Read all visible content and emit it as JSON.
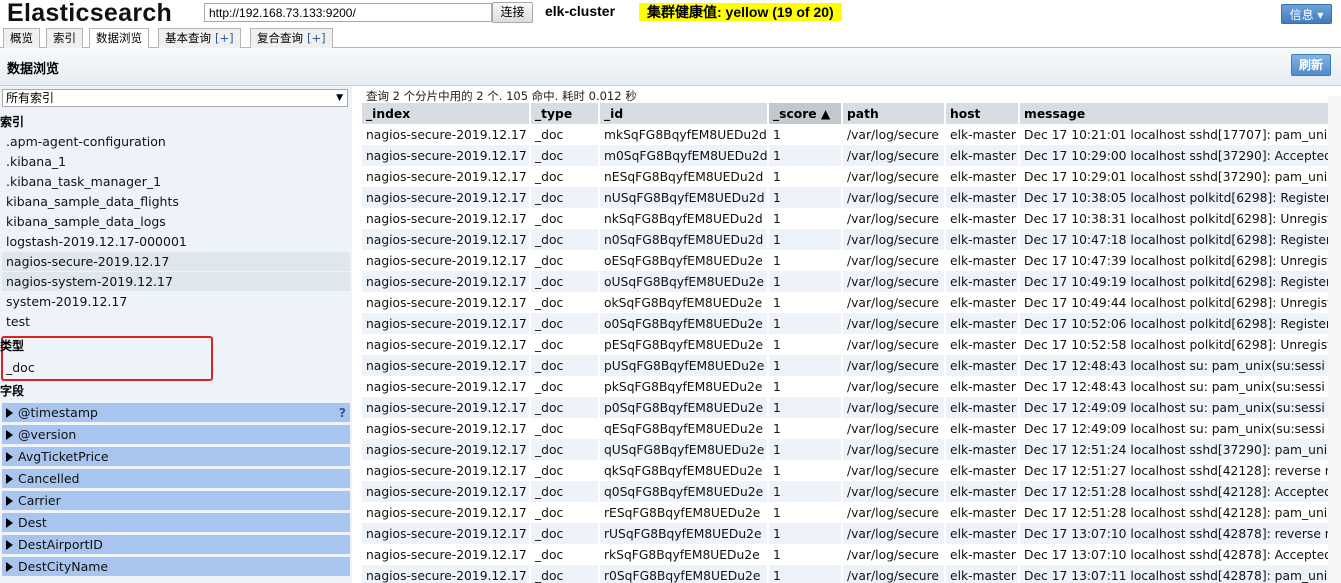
{
  "header": {
    "app_title": "Elasticsearch",
    "url_value": "http://192.168.73.133:9200/",
    "connect_label": "连接",
    "cluster_name": "elk-cluster",
    "health_text": "集群健康值: yellow (19 of 20)",
    "info_label": "信息 ▾",
    "health_color": "#ffff00"
  },
  "tabs": [
    {
      "label": "概览",
      "plus": ""
    },
    {
      "label": "索引",
      "plus": ""
    },
    {
      "label": "数据浏览",
      "plus": ""
    },
    {
      "label": "基本查询",
      "plus": "[+]"
    },
    {
      "label": "复合查询",
      "plus": "[+]"
    }
  ],
  "panel": {
    "title": "数据浏览",
    "refresh_label": "刷新"
  },
  "sidebar": {
    "index_select": "所有索引",
    "indices_header": "索引",
    "indices": [
      ".apm-agent-configuration",
      ".kibana_1",
      ".kibana_task_manager_1",
      "kibana_sample_data_flights",
      "kibana_sample_data_logs",
      "logstash-2019.12.17-000001",
      "nagios-secure-2019.12.17",
      "nagios-system-2019.12.17",
      "system-2019.12.17",
      "test"
    ],
    "types_header": "类型",
    "types": [
      "_doc"
    ],
    "fields_header": "字段",
    "fields": [
      "@timestamp",
      "@version",
      "AvgTicketPrice",
      "Cancelled",
      "Carrier",
      "Dest",
      "DestAirportID",
      "DestCityName"
    ],
    "help_icon": "?"
  },
  "results": {
    "summary": "查询 2 个分片中用的 2 个. 105 命中. 耗时 0.012 秒",
    "columns": [
      "_index",
      "_type",
      "_id",
      "_score ▲",
      "path",
      "host",
      "message"
    ],
    "rows": [
      [
        "nagios-secure-2019.12.17",
        "_doc",
        "mkSqFG8BqyfEM8UEDu2d",
        "1",
        "/var/log/secure",
        "elk-master",
        "Dec 17 10:21:01 localhost sshd[17707]: pam_uni"
      ],
      [
        "nagios-secure-2019.12.17",
        "_doc",
        "m0SqFG8BqyfEM8UEDu2d",
        "1",
        "/var/log/secure",
        "elk-master",
        "Dec 17 10:29:00 localhost sshd[37290]: Accepted"
      ],
      [
        "nagios-secure-2019.12.17",
        "_doc",
        "nESqFG8BqyfEM8UEDu2d",
        "1",
        "/var/log/secure",
        "elk-master",
        "Dec 17 10:29:01 localhost sshd[37290]: pam_uni"
      ],
      [
        "nagios-secure-2019.12.17",
        "_doc",
        "nUSqFG8BqyfEM8UEDu2d",
        "1",
        "/var/log/secure",
        "elk-master",
        "Dec 17 10:38:05 localhost polkitd[6298]: Register"
      ],
      [
        "nagios-secure-2019.12.17",
        "_doc",
        "nkSqFG8BqyfEM8UEDu2d",
        "1",
        "/var/log/secure",
        "elk-master",
        "Dec 17 10:38:31 localhost polkitd[6298]: Unregist"
      ],
      [
        "nagios-secure-2019.12.17",
        "_doc",
        "n0SqFG8BqyfEM8UEDu2d",
        "1",
        "/var/log/secure",
        "elk-master",
        "Dec 17 10:47:18 localhost polkitd[6298]: Register"
      ],
      [
        "nagios-secure-2019.12.17",
        "_doc",
        "oESqFG8BqyfEM8UEDu2e",
        "1",
        "/var/log/secure",
        "elk-master",
        "Dec 17 10:47:39 localhost polkitd[6298]: Unregist"
      ],
      [
        "nagios-secure-2019.12.17",
        "_doc",
        "oUSqFG8BqyfEM8UEDu2e",
        "1",
        "/var/log/secure",
        "elk-master",
        "Dec 17 10:49:19 localhost polkitd[6298]: Register"
      ],
      [
        "nagios-secure-2019.12.17",
        "_doc",
        "okSqFG8BqyfEM8UEDu2e",
        "1",
        "/var/log/secure",
        "elk-master",
        "Dec 17 10:49:44 localhost polkitd[6298]: Unregist"
      ],
      [
        "nagios-secure-2019.12.17",
        "_doc",
        "o0SqFG8BqyfEM8UEDu2e",
        "1",
        "/var/log/secure",
        "elk-master",
        "Dec 17 10:52:06 localhost polkitd[6298]: Register"
      ],
      [
        "nagios-secure-2019.12.17",
        "_doc",
        "pESqFG8BqyfEM8UEDu2e",
        "1",
        "/var/log/secure",
        "elk-master",
        "Dec 17 10:52:58 localhost polkitd[6298]: Unregist"
      ],
      [
        "nagios-secure-2019.12.17",
        "_doc",
        "pUSqFG8BqyfEM8UEDu2e",
        "1",
        "/var/log/secure",
        "elk-master",
        "Dec 17 12:48:43 localhost su: pam_unix(su:sessi"
      ],
      [
        "nagios-secure-2019.12.17",
        "_doc",
        "pkSqFG8BqyfEM8UEDu2e",
        "1",
        "/var/log/secure",
        "elk-master",
        "Dec 17 12:48:43 localhost su: pam_unix(su:sessi"
      ],
      [
        "nagios-secure-2019.12.17",
        "_doc",
        "p0SqFG8BqyfEM8UEDu2e",
        "1",
        "/var/log/secure",
        "elk-master",
        "Dec 17 12:49:09 localhost su: pam_unix(su:sessi"
      ],
      [
        "nagios-secure-2019.12.17",
        "_doc",
        "qESqFG8BqyfEM8UEDu2e",
        "1",
        "/var/log/secure",
        "elk-master",
        "Dec 17 12:49:09 localhost su: pam_unix(su:sessi"
      ],
      [
        "nagios-secure-2019.12.17",
        "_doc",
        "qUSqFG8BqyfEM8UEDu2e",
        "1",
        "/var/log/secure",
        "elk-master",
        "Dec 17 12:51:24 localhost sshd[37290]: pam_uni"
      ],
      [
        "nagios-secure-2019.12.17",
        "_doc",
        "qkSqFG8BqyfEM8UEDu2e",
        "1",
        "/var/log/secure",
        "elk-master",
        "Dec 17 12:51:27 localhost sshd[42128]: reverse n"
      ],
      [
        "nagios-secure-2019.12.17",
        "_doc",
        "q0SqFG8BqyfEM8UEDu2e",
        "1",
        "/var/log/secure",
        "elk-master",
        "Dec 17 12:51:28 localhost sshd[42128]: Accepted"
      ],
      [
        "nagios-secure-2019.12.17",
        "_doc",
        "rESqFG8BqyfEM8UEDu2e",
        "1",
        "/var/log/secure",
        "elk-master",
        "Dec 17 12:51:28 localhost sshd[42128]: pam_uni"
      ],
      [
        "nagios-secure-2019.12.17",
        "_doc",
        "rUSqFG8BqyfEM8UEDu2e",
        "1",
        "/var/log/secure",
        "elk-master",
        "Dec 17 13:07:10 localhost sshd[42878]: reverse n"
      ],
      [
        "nagios-secure-2019.12.17",
        "_doc",
        "rkSqFG8BqyfEM8UEDu2e",
        "1",
        "/var/log/secure",
        "elk-master",
        "Dec 17 13:07:10 localhost sshd[42878]: Accepted"
      ],
      [
        "nagios-secure-2019.12.17",
        "_doc",
        "r0SqFG8BqyfEM8UEDu2e",
        "1",
        "/var/log/secure",
        "elk-master",
        "Dec 17 13:07:11 localhost sshd[42878]: pam_uni"
      ]
    ]
  }
}
